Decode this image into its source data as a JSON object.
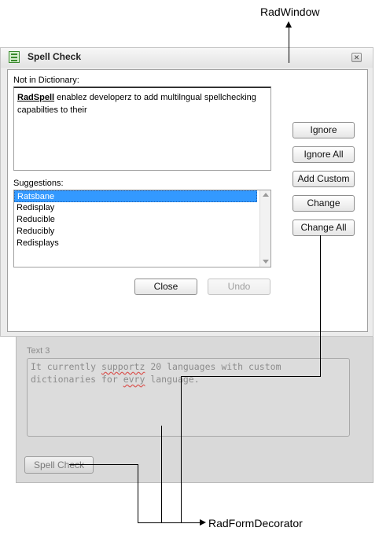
{
  "annotations": {
    "top": "RadWindow",
    "bottom": "RadFormDecorator"
  },
  "window": {
    "title": "Spell Check",
    "title_icon": "spellcheck-icon",
    "close_icon": "close-icon",
    "not_in_dictionary_label": "Not in Dictionary:",
    "not_in_dictionary_word": "RadSpell",
    "not_in_dictionary_text": " enablez developerz to add multilngual spellchecking capabilties to their",
    "suggestions_label": "Suggestions:",
    "suggestions": [
      "Ratsbane",
      "Redisplay",
      "Reducible",
      "Reducibly",
      "Redisplays"
    ],
    "selected_suggestion": 0,
    "buttons": {
      "ignore": "Ignore",
      "ignore_all": "Ignore All",
      "add_custom": "Add Custom",
      "change": "Change",
      "change_all": "Change All",
      "close": "Close",
      "undo": "Undo"
    }
  },
  "form": {
    "text_label": "Text 3",
    "text_parts": {
      "p1": "It currently ",
      "p2": "supportz",
      "p3": " 20 languages with custom dictionaries for ",
      "p4": "evry",
      "p5": " language."
    },
    "spell_check_button": "Spell Check"
  }
}
